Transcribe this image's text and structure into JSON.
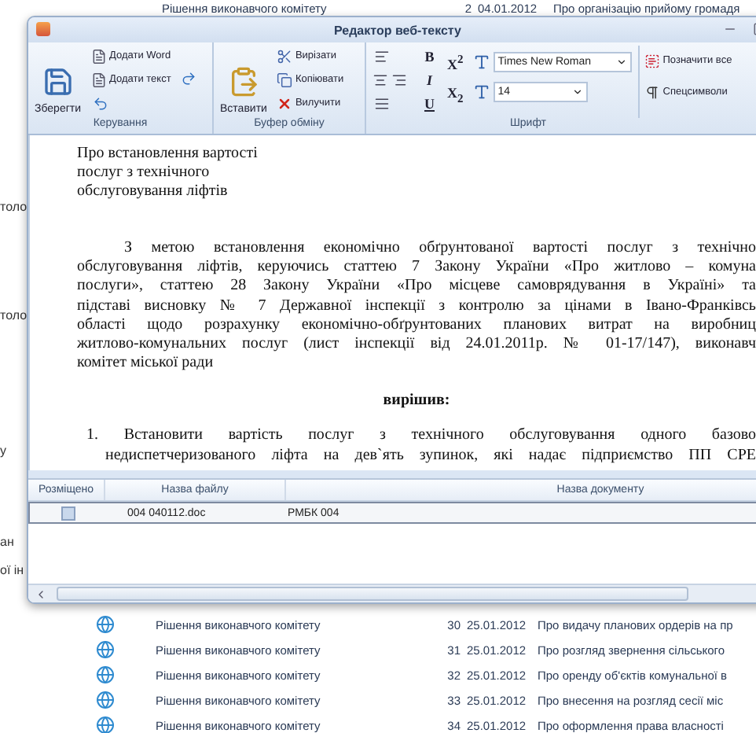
{
  "background_app": {
    "left_fragments": [
      "толо",
      "толо",
      "у",
      "ан",
      "ої ін"
    ],
    "top_row": {
      "title": "Рішення виконавчого комітету",
      "number": "2",
      "date": "04.01.2012",
      "subject": "Про організацію прийому громадя"
    },
    "rows": [
      {
        "title": "Рішення виконавчого комітету",
        "number": "30",
        "date": "25.01.2012",
        "subject": "Про видачу планових ордерів на пр"
      },
      {
        "title": "Рішення виконавчого комітету",
        "number": "31",
        "date": "25.01.2012",
        "subject": "Про розгляд звернення сільського"
      },
      {
        "title": "Рішення виконавчого комітету",
        "number": "32",
        "date": "25.01.2012",
        "subject": "Про оренду об'єктів комунальної в"
      },
      {
        "title": "Рішення виконавчого комітету",
        "number": "33",
        "date": "25.01.2012",
        "subject": "Про внесення на розгляд сесії міс"
      },
      {
        "title": "Рішення виконавчого комітету",
        "number": "34",
        "date": "25.01.2012",
        "subject": "Про оформлення права власності"
      }
    ]
  },
  "window": {
    "title": "Редактор веб-тексту"
  },
  "ribbon": {
    "manage": {
      "label": "Керування",
      "save": "Зберегти",
      "add_word": "Додати Word",
      "add_text": "Додати текст"
    },
    "clipboard": {
      "label": "Буфер обміну",
      "paste": "Вставити",
      "cut": "Вирізати",
      "copy": "Копіювати",
      "delete": "Вилучити"
    },
    "font": {
      "label": "Шрифт",
      "bold": "B",
      "italic": "I",
      "underline": "U",
      "superscript": "X$^{2}$",
      "subscript": "X$_{2}$",
      "font_name": "Times New Roman",
      "font_size": "14",
      "select_all": "Позначити все",
      "special_chars": "Спецсимволи"
    }
  },
  "document": {
    "heading_lines": [
      "Про встановлення вартості",
      "послуг з  технічного",
      "обслуговування ліфтів"
    ],
    "paragraph_lines": [
      "З метою встановлення економічно обґрунтованої вартості послуг з   технічно",
      "обслуговування ліфтів, керуючись статтею 7 Закону України «Про житлово – комуна",
      "послуги», статтею 28 Закону України «Про місцеве самоврядування в Україні» та",
      "підставі висновку № 7 Державної інспекції з контролю за цінами в Івано-Франківсь",
      "області щодо розрахунку економічно-обґрунтованих планових витрат на виробниц",
      "житлово-комунальних послуг (лист інспекції від 24.01.2011р. № 01-17/147),  виконавч",
      "комітет міської ради"
    ],
    "resolution": "вирішив:",
    "item_lines": [
      "1. Встановити вартість послуг з технічного обслуговування одного базово",
      "недиспетчеризованого ліфта на дев`ять зупинок, які надає підприємство ПП СРЕ"
    ]
  },
  "files_grid": {
    "columns": [
      "Розміщено",
      "Назва файлу",
      "Назва документу"
    ],
    "rows": [
      {
        "placed": false,
        "selected": true,
        "file": "004 040112.doc",
        "document": "РМБК 004"
      }
    ]
  }
}
